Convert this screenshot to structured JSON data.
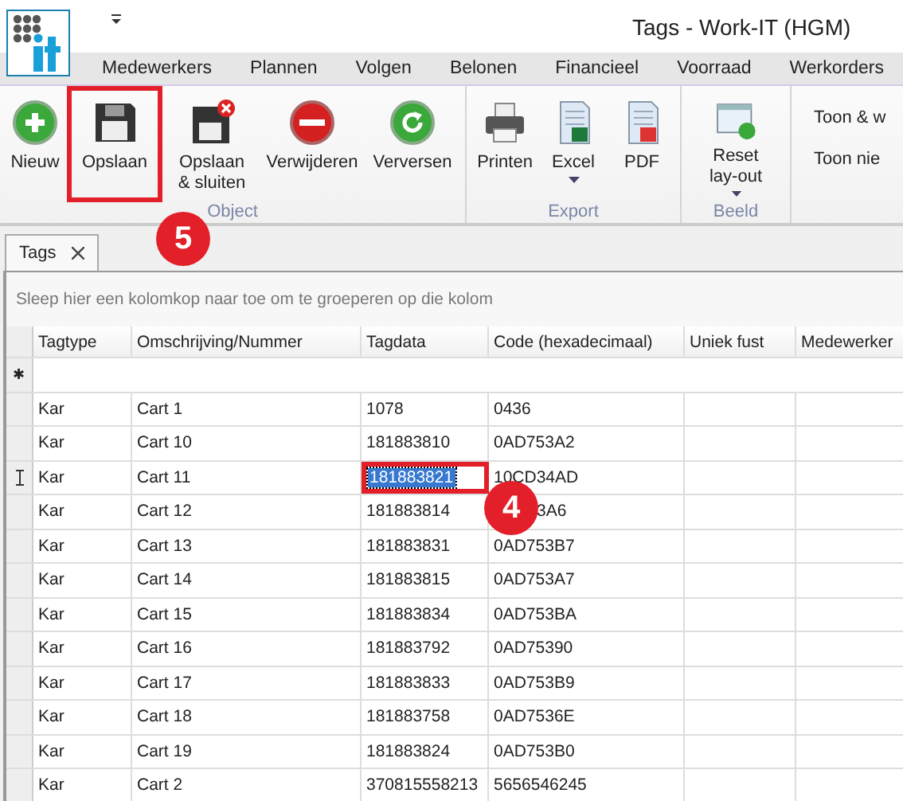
{
  "window": {
    "title": "Tags - Work-IT (HGM)"
  },
  "ribbon_tabs": [
    {
      "label": "Medewerkers",
      "selected": false
    },
    {
      "label": "Plannen",
      "selected": false
    },
    {
      "label": "Volgen",
      "selected": false
    },
    {
      "label": "Belonen",
      "selected": false
    },
    {
      "label": "Financieel",
      "selected": false
    },
    {
      "label": "Voorraad",
      "selected": false
    },
    {
      "label": "Werkorders",
      "selected": false
    }
  ],
  "ribbon_groups": [
    {
      "label": "Object",
      "buttons": [
        {
          "kind": "new",
          "label": "Nieuw",
          "highlighted": false
        },
        {
          "kind": "save",
          "label": "Opslaan",
          "highlighted": true
        },
        {
          "kind": "save_close",
          "label": "Opslaan & sluiten",
          "highlighted": false
        },
        {
          "kind": "delete",
          "label": "Verwijderen",
          "highlighted": false
        },
        {
          "kind": "refresh",
          "label": "Verversen",
          "highlighted": false
        }
      ]
    },
    {
      "label": "Export",
      "buttons": [
        {
          "kind": "print",
          "label": "Printen",
          "highlighted": false
        },
        {
          "kind": "excel",
          "label": "Excel",
          "highlighted": false
        },
        {
          "kind": "pdf",
          "label": "PDF",
          "highlighted": false
        }
      ]
    },
    {
      "label": "Beeld",
      "buttons": [
        {
          "kind": "reset",
          "label": "Reset lay-out",
          "highlighted": false
        }
      ]
    },
    {
      "links": [
        "Toon & w",
        "Toon nie"
      ]
    }
  ],
  "document_tabs": [
    {
      "label": "Tags",
      "selected": true
    }
  ],
  "group_panel": {
    "hint": "Sleep hier een kolomkop naar toe om te groeperen op die kolom"
  },
  "table": {
    "new_row_marker": "✱",
    "columns": [
      "Tagtype",
      "Omschrijving/Nummer",
      "Tagdata",
      "Code (hexadecimaal)",
      "Uniek fust",
      "Medewerker"
    ],
    "rows": [
      {
        "tagtype": "Kar",
        "name": "Cart 1",
        "tagdata": "1078",
        "code": "0436",
        "editing": false,
        "covered": false
      },
      {
        "tagtype": "Kar",
        "name": "Cart 10",
        "tagdata": "181883810",
        "code": "0AD753A2",
        "editing": false,
        "covered": false
      },
      {
        "tagtype": "Kar",
        "name": "Cart 11",
        "tagdata": "181883821",
        "code": "10CD34AD",
        "editing": true,
        "covered": false
      },
      {
        "tagtype": "Kar",
        "name": "Cart 12",
        "tagdata": "181883814",
        "code": "3A6",
        "editing": false,
        "covered": true
      },
      {
        "tagtype": "Kar",
        "name": "Cart 13",
        "tagdata": "181883831",
        "code": "0AD753B7",
        "editing": false,
        "covered": false
      },
      {
        "tagtype": "Kar",
        "name": "Cart 14",
        "tagdata": "181883815",
        "code": "0AD753A7",
        "editing": false,
        "covered": false
      },
      {
        "tagtype": "Kar",
        "name": "Cart 15",
        "tagdata": "181883834",
        "code": "0AD753BA",
        "editing": false,
        "covered": false
      },
      {
        "tagtype": "Kar",
        "name": "Cart 16",
        "tagdata": "181883792",
        "code": "0AD75390",
        "editing": false,
        "covered": false
      },
      {
        "tagtype": "Kar",
        "name": "Cart 17",
        "tagdata": "181883833",
        "code": "0AD753B9",
        "editing": false,
        "covered": false
      },
      {
        "tagtype": "Kar",
        "name": "Cart 18",
        "tagdata": "181883758",
        "code": "0AD7536E",
        "editing": false,
        "covered": false
      },
      {
        "tagtype": "Kar",
        "name": "Cart 19",
        "tagdata": "181883824",
        "code": "0AD753B0",
        "editing": false,
        "covered": false
      },
      {
        "tagtype": "Kar",
        "name": "Cart 2",
        "tagdata": "370815558213",
        "code": "5656546245",
        "editing": false,
        "covered": false
      }
    ]
  },
  "callouts": [
    {
      "label": "5"
    },
    {
      "label": "4"
    }
  ]
}
